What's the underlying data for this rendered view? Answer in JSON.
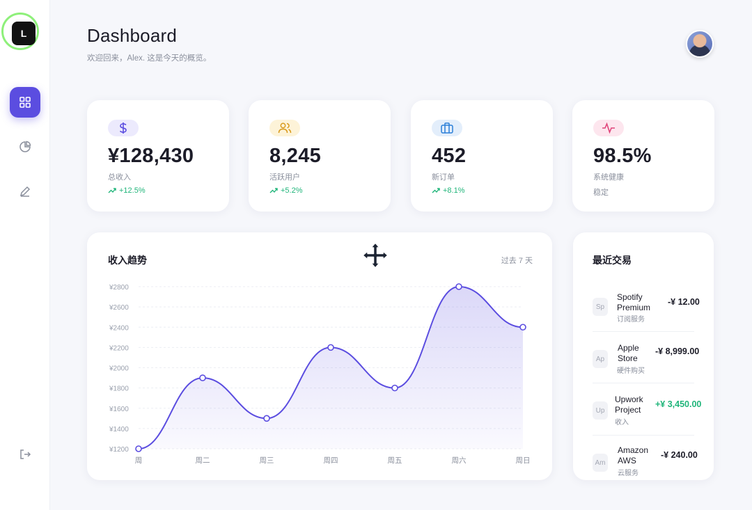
{
  "header": {
    "title": "Dashboard",
    "subtitle": "欢迎回来，Alex. 这是今天的概览。"
  },
  "logo": {
    "text": "L"
  },
  "sidebar": {
    "items": [
      {
        "icon": "grid-icon",
        "active": true
      },
      {
        "icon": "pie-chart-icon",
        "active": false
      },
      {
        "icon": "pencil-icon",
        "active": false
      }
    ],
    "logout_icon": "logout-icon"
  },
  "stats": [
    {
      "icon": "dollar-icon",
      "value": "¥128,430",
      "label": "总收入",
      "trend": "+12.5%",
      "color": "#5b4de0",
      "icon_bg": "#eceafd"
    },
    {
      "icon": "users-icon",
      "value": "8,245",
      "label": "活跃用户",
      "trend": "+5.2%",
      "color": "#d99a1c",
      "icon_bg": "#fdf3d8"
    },
    {
      "icon": "briefcase-icon",
      "value": "452",
      "label": "新订单",
      "trend": "+8.1%",
      "color": "#2b7fd8",
      "icon_bg": "#e3eefb"
    },
    {
      "icon": "activity-icon",
      "value": "98.5%",
      "label": "系统健康",
      "trend": "稳定",
      "color": "#e0447a",
      "icon_bg": "#fde6ee"
    }
  ],
  "chart": {
    "title": "收入趋势",
    "range_label": "过去 7 天"
  },
  "chart_data": {
    "type": "area",
    "categories": [
      "周",
      "周二",
      "周三",
      "周四",
      "周五",
      "周六",
      "周日"
    ],
    "values": [
      1200,
      1900,
      1500,
      2200,
      1800,
      2800,
      2400
    ],
    "ylim": [
      1200,
      2800
    ],
    "yticks": [
      "¥2800",
      "¥2600",
      "¥2400",
      "¥2200",
      "¥2000",
      "¥1800",
      "¥1600",
      "¥1400",
      "¥1200"
    ],
    "line_color": "#5b4de0",
    "grid": true
  },
  "transactions": {
    "title": "最近交易",
    "items": [
      {
        "badge": "Sp",
        "name": "Spotify Premium",
        "category": "订阅服务",
        "amount": "-¥ 12.00",
        "positive": false
      },
      {
        "badge": "Ap",
        "name": "Apple Store",
        "category": "硬件购买",
        "amount": "-¥ 8,999.00",
        "positive": false
      },
      {
        "badge": "Up",
        "name": "Upwork Project",
        "category": "收入",
        "amount": "+¥ 3,450.00",
        "positive": true
      },
      {
        "badge": "Am",
        "name": "Amazon AWS",
        "category": "云服务",
        "amount": "-¥ 240.00",
        "positive": false
      }
    ]
  }
}
